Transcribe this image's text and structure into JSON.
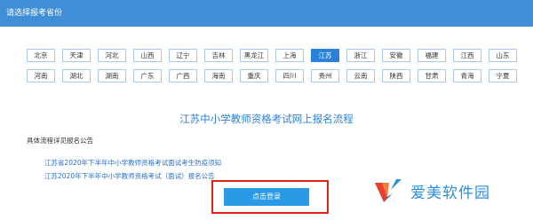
{
  "header": {
    "title": "请选择报考省份"
  },
  "provinces": {
    "row1": [
      "北京",
      "天津",
      "河北",
      "山西",
      "辽宁",
      "吉林",
      "黑龙江",
      "上海",
      "江苏",
      "浙江",
      "安徽",
      "福建",
      "江西",
      "山东"
    ],
    "row2": [
      "河南",
      "湖北",
      "湖南",
      "广东",
      "广西",
      "海南",
      "重庆",
      "四川",
      "贵州",
      "云南",
      "陕西",
      "甘肃",
      "青海",
      "宁夏"
    ],
    "selected": "江苏"
  },
  "main": {
    "flow_title": "江苏中小学教师资格考试网上报名流程",
    "detail_label": "具体流程详见报名公告",
    "links": [
      "江苏省2020年下半年中小学教师资格考试面试考生防疫须知",
      "江苏2020年下半年中小学教师资格考试（面试）报名公告"
    ],
    "login_button": "点击登录"
  },
  "watermark": {
    "text": "爱美软件园"
  },
  "colors": {
    "accent": "#2a82d8",
    "header": "#3f8ed6",
    "highlight": "#e0221a"
  }
}
